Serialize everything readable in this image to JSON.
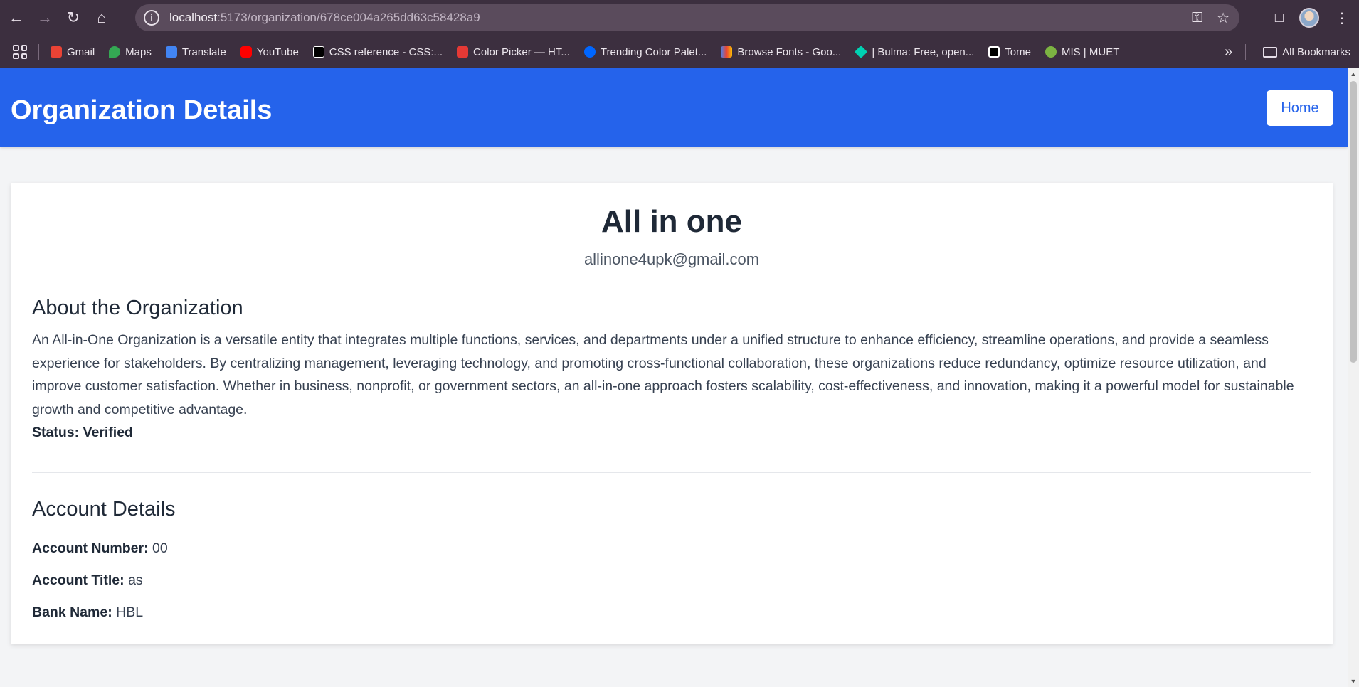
{
  "browser": {
    "url_host": "localhost",
    "url_path": ":5173/organization/678ce004a265dd63c58428a9",
    "bookmarks": [
      {
        "label": "Gmail",
        "icon": "gmail-icon",
        "color": "#ea4335"
      },
      {
        "label": "Maps",
        "icon": "maps-icon",
        "color": "#34a853"
      },
      {
        "label": "Translate",
        "icon": "translate-icon",
        "color": "#4285f4"
      },
      {
        "label": "YouTube",
        "icon": "youtube-icon",
        "color": "#ff0000"
      },
      {
        "label": "CSS reference - CSS:...",
        "icon": "mdn-icon",
        "color": "#000000"
      },
      {
        "label": "Color Picker — HT...",
        "icon": "colorpicker-icon",
        "color": "#e53935"
      },
      {
        "label": "Trending Color Palet...",
        "icon": "coolors-icon",
        "color": "#0066ff"
      },
      {
        "label": "Browse Fonts - Goo...",
        "icon": "googlefonts-icon",
        "color": "#4285f4"
      },
      {
        "label": "| Bulma: Free, open...",
        "icon": "bulma-icon",
        "color": "#00d1b2"
      },
      {
        "label": "Tome",
        "icon": "tome-icon",
        "color": "#000000"
      },
      {
        "label": "MIS | MUET",
        "icon": "muet-icon",
        "color": "#7cb342"
      }
    ],
    "all_bookmarks": "All Bookmarks"
  },
  "header": {
    "title": "Organization Details",
    "home_label": "Home"
  },
  "organization": {
    "name": "All in one",
    "email": "allinone4upk@gmail.com",
    "about_heading": "About the Organization",
    "about_text": "An All-in-One Organization is a versatile entity that integrates multiple functions, services, and departments under a unified structure to enhance efficiency, streamline operations, and provide a seamless experience for stakeholders. By centralizing management, leveraging technology, and promoting cross-functional collaboration, these organizations reduce redundancy, optimize resource utilization, and improve customer satisfaction. Whether in business, nonprofit, or government sectors, an all-in-one approach fosters scalability, cost-effectiveness, and innovation, making it a powerful model for sustainable growth and competitive advantage.",
    "status_label": "Status:",
    "status_value": "Verified"
  },
  "account": {
    "heading": "Account Details",
    "number_label": "Account Number:",
    "number_value": "00",
    "title_label": "Account Title:",
    "title_value": "as",
    "bank_label": "Bank Name:",
    "bank_value": "HBL"
  },
  "colors": {
    "header_bg": "#2563eb",
    "page_bg": "#f3f4f6",
    "browser_chrome": "#3c2f3f"
  }
}
